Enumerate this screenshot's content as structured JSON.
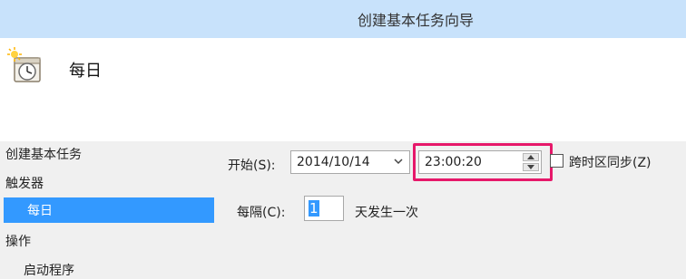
{
  "window": {
    "title": "创建基本任务向导"
  },
  "header": {
    "heading": "每日",
    "icon": "calendar-clock-icon"
  },
  "sidebar": {
    "items": [
      {
        "label": "创建基本任务"
      },
      {
        "label": "触发器"
      },
      {
        "label": "每日"
      },
      {
        "label": "操作"
      },
      {
        "label": "启动程序"
      }
    ],
    "selected_index": 2
  },
  "form": {
    "start_label": "开始(S):",
    "start_date": "2014/10/14",
    "start_time": "23:00:20",
    "sync_label": "跨时区同步(Z)",
    "sync_checked": false,
    "interval_label": "每隔(C):",
    "interval_value": "1",
    "interval_suffix": "天发生一次"
  },
  "colors": {
    "titlebar": "#c8e2fb",
    "selection": "#3399ff",
    "highlight": "#e6186a"
  }
}
